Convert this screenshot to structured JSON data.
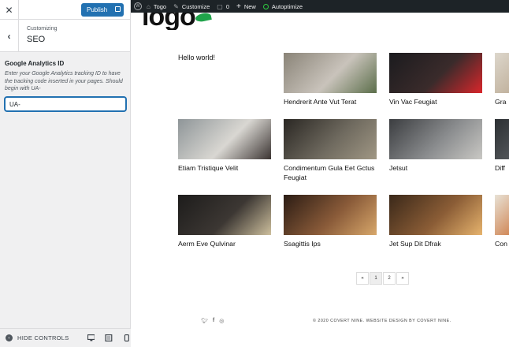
{
  "sidebar": {
    "publish_label": "Publish",
    "breadcrumb": "Customizing",
    "section_title": "SEO",
    "control_label": "Google Analytics ID",
    "control_description": "Enter your Google Analytics tracking ID to have the tracking code inserted in your pages. Should begin with UA-",
    "control_value": "UA-",
    "hide_controls": "HIDE CONTROLS"
  },
  "adminbar": {
    "site_name": "Togo",
    "customize": "Customize",
    "comments_count": "0",
    "new_label": "New",
    "autoptimize": "Autoptimize"
  },
  "preview": {
    "logo_text": "logo",
    "first_post": "Hello world!",
    "posts": [
      {
        "title": "Hendrerit Ante Vut Terat",
        "colors": [
          "#8a8478",
          "#c9c3bb",
          "#5b6e4a"
        ]
      },
      {
        "title": "Vin Vac Feugiat",
        "colors": [
          "#1b1b1e",
          "#3a2b2b",
          "#d9262b"
        ]
      },
      {
        "title": "Gra",
        "colors": [
          "#ddd7cc",
          "#b8a68f",
          "#6e5d4b"
        ]
      },
      {
        "title": "Etiam Tristique Velit",
        "colors": [
          "#8e9598",
          "#d9d7d2",
          "#3b3432"
        ]
      },
      {
        "title": "Condimentum Gula Eet Gctus Feugiat",
        "colors": [
          "#2a2723",
          "#6f6a5f",
          "#a09784"
        ]
      },
      {
        "title": "Jetsut",
        "colors": [
          "#3b3d40",
          "#8a8c8e",
          "#c9c8c4"
        ]
      },
      {
        "title": "Diff",
        "colors": [
          "#2c3033",
          "#5e6165",
          "#9aa0a3"
        ]
      },
      {
        "title": "Aerm Eve Qulvinar",
        "colors": [
          "#1d1c1b",
          "#3c3733",
          "#cdbf9d"
        ]
      },
      {
        "title": "Ssagittis Ips",
        "colors": [
          "#2b1c14",
          "#8a5b39",
          "#d7a76a"
        ]
      },
      {
        "title": "Jet Sup Dit Dfrak",
        "colors": [
          "#3a2819",
          "#8b5d36",
          "#e6b36d"
        ]
      },
      {
        "title": "Con Gtu",
        "colors": [
          "#e8e2d6",
          "#c96a2e",
          "#5b7c3a"
        ]
      }
    ],
    "pagination": [
      "«",
      "1",
      "2",
      "»"
    ],
    "social_icons": [
      "twitter-icon",
      "facebook-icon",
      "instagram-icon"
    ],
    "copyright": "© 2020 COVERT NINE. WEBSITE DESIGN BY COVERT NINE."
  },
  "colors": {
    "accent": "#2271b1",
    "adminbar": "#1d2327",
    "sidebar_bg": "#f0f0f1"
  }
}
